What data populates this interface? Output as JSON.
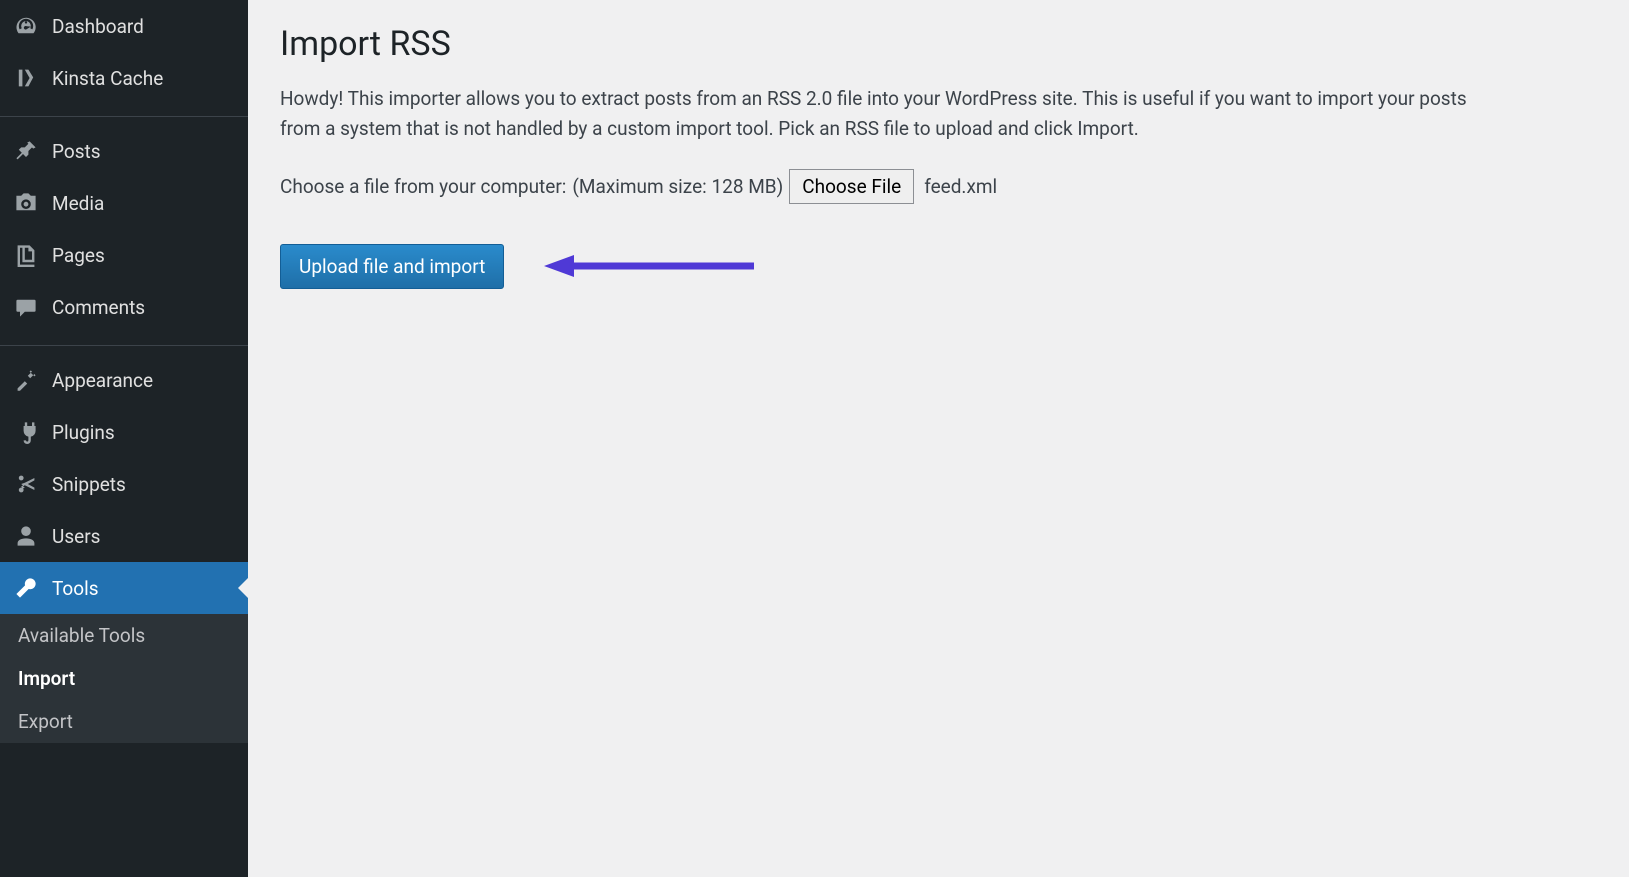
{
  "sidebar": {
    "items": [
      {
        "label": "Dashboard"
      },
      {
        "label": "Kinsta Cache"
      },
      {
        "label": "Posts"
      },
      {
        "label": "Media"
      },
      {
        "label": "Pages"
      },
      {
        "label": "Comments"
      },
      {
        "label": "Appearance"
      },
      {
        "label": "Plugins"
      },
      {
        "label": "Snippets"
      },
      {
        "label": "Users"
      },
      {
        "label": "Tools"
      }
    ],
    "submenu": [
      {
        "label": "Available Tools"
      },
      {
        "label": "Import"
      },
      {
        "label": "Export"
      }
    ]
  },
  "page": {
    "title": "Import RSS",
    "description": "Howdy! This importer allows you to extract posts from an RSS 2.0 file into your WordPress site. This is useful if you want to import your posts from a system that is not handled by a custom import tool. Pick an RSS file to upload and click Import.",
    "file_label": "Choose a file from your computer:",
    "max_size": "(Maximum size: 128 MB)",
    "choose_file_button": "Choose File",
    "selected_file": "feed.xml",
    "upload_button": "Upload file and import"
  }
}
